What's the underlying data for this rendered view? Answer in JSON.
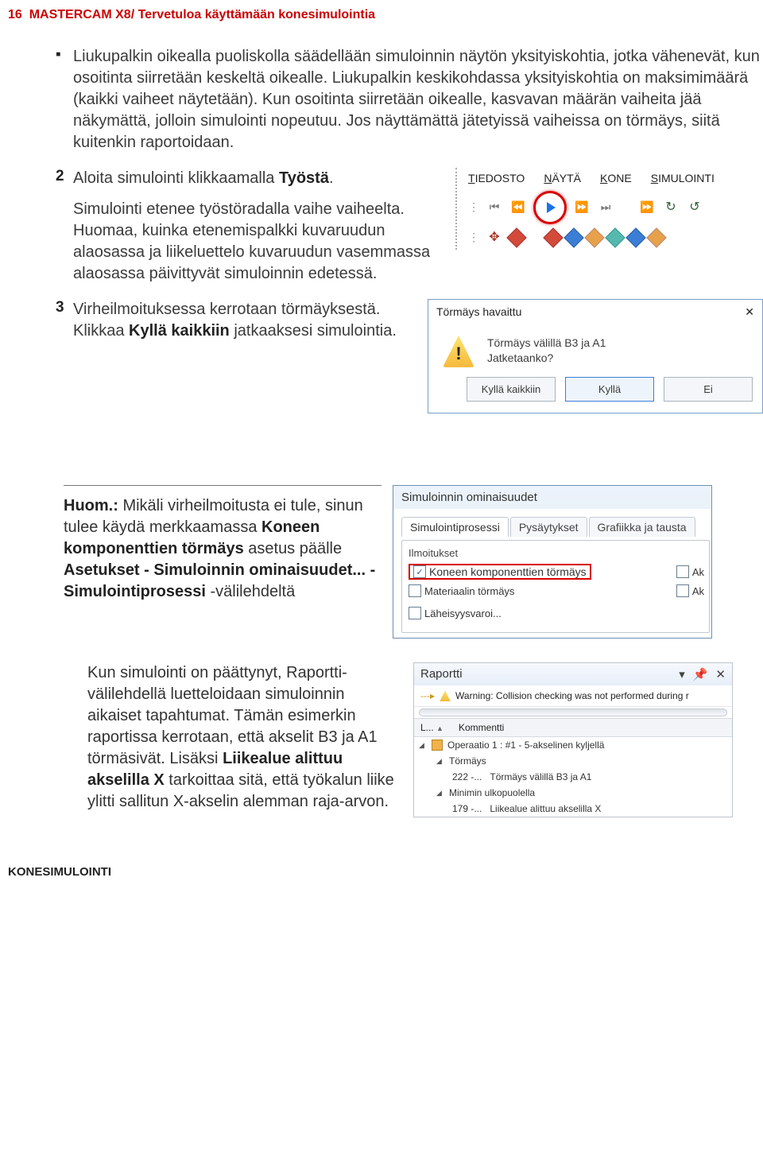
{
  "header": {
    "page_num": "16",
    "title": "MASTERCAM X8/ Tervetuloa käyttämään konesimulointia"
  },
  "bullet1": "Liukupalkin oikealla puoliskolla säädellään simuloinnin näytön yksityiskohtia, jotka vähenevät, kun osoitinta siirretään keskeltä oikealle. Liukupalkin keskikohdassa yksityiskohtia on maksimimäärä (kaikki vaiheet näytetään). Kun osoitinta siirretään oikealle, kasvavan määrän vaiheita jää näkymättä, jolloin simulointi nopeutuu. Jos näyttämättä jätetyissä vaiheissa on törmäys, siitä kuitenkin raportoidaan.",
  "item2": {
    "lead": "Aloita simulointi klikkaamalla ",
    "bold": "Työstä",
    "tail": ".",
    "p2": "Simulointi etenee työstöradalla vaihe vaiheelta. Huomaa, kuinka etenemispalkki kuvaruudun alaosassa ja liikeluettelo kuvaruudun vasemmassa alaosassa päivittyvät simuloinnin edetessä."
  },
  "item3": {
    "p_a": "Virheilmoituksessa kerrotaan törmäyksestä. Klikkaa ",
    "p_bold": "Kyllä kaikkiin",
    "p_b": " jatkaaksesi simulointia."
  },
  "toolbar_menu": {
    "m1": "TIEDOSTO",
    "m2": "NÄYTÄ",
    "m3": "KONE",
    "m4": "SIMULOINTI"
  },
  "dialog": {
    "title": "Törmäys havaittu",
    "line1": "Törmäys välillä B3 ja A1",
    "line2": "Jatketaanko?",
    "btn_all": "Kyllä kaikkiin",
    "btn_yes": "Kyllä",
    "btn_no": "Ei"
  },
  "note": {
    "lead": "Huom.:",
    "body_a": " Mikäli virheilmoitusta ei tule, sinun tulee käydä merkkaa­massa ",
    "bold1": "Koneen komponenttien törmäys",
    "body_b": " asetus päälle ",
    "bold2": "Asetukset - Simuloinnin ominaisuudet... - Simulointiprosessi",
    "body_c": " -välilehdeltä"
  },
  "props": {
    "title": "Simuloinnin ominaisuudet",
    "tab1": "Simulointiprosessi",
    "tab2": "Pysäytykset",
    "tab3": "Grafiikka ja tausta",
    "group": "Ilmoitukset",
    "opt1": "Koneen komponenttien törmäys",
    "opt2": "Materiaalin törmäys",
    "opt3": "Läheisyysvaroi...",
    "ak": "Ak"
  },
  "report_text": {
    "p_a": "Kun simulointi on päättynyt, Raportti-välilehdellä luetteloidaan simuloinnin aikaiset tapahtumat. Tämän esimerkin raportissa kerrotaan, että akselit B3 ja A1 törmäsivät. Lisäksi ",
    "p_bold": "Liikealue alittuu akselilla X",
    "p_b": " tarkoittaa sitä, että työkalun liike ylitti sallitun X-akselin alemman raja-arvon."
  },
  "report_panel": {
    "title": "Raportti",
    "warn": "Warning: Collision checking was not performed during r",
    "hdr_l": "L...",
    "hdr_k": "Kommentti",
    "r1": "Operaatio 1 : #1 - 5-akselinen kyljellä",
    "r2_h": "Törmäys",
    "r2_n": "222 -...",
    "r2_t": "Törmäys välillä B3 ja A1",
    "r3_h": "Minimin ulkopuolella",
    "r3_n": "179 -...",
    "r3_t": "Liikealue alittuu akselilla X"
  },
  "footer": "KONESIMULOINTI"
}
